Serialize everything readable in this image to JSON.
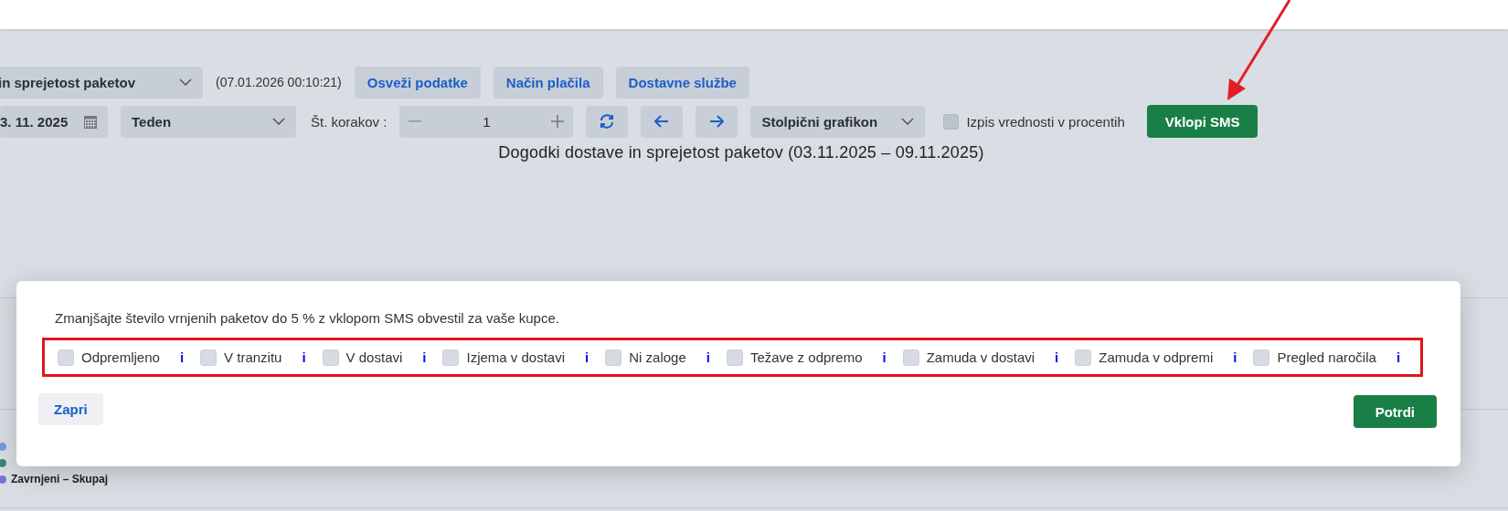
{
  "toolbar": {
    "report_select": {
      "value": "in sprejetost paketov"
    },
    "timestamp": "(07.01.2026 00:10:21)",
    "buttons": [
      "Osveži podatke",
      "Način plačila",
      "Dostavne službe"
    ],
    "date_field": {
      "value": "3. 11. 2025"
    },
    "period_select": {
      "value": "Teden"
    },
    "steps_label": "Št. korakov :",
    "steps_field": {
      "value": "1"
    },
    "chart_type_select": {
      "value": "Stolpični grafikon"
    },
    "percent_checkbox": {
      "label": "Izpis vrednosti v procentih",
      "checked": false
    },
    "sms_button": "Vklopi SMS"
  },
  "chart_title": "Dogodki dostave in sprejetost paketov (03.11.2025 – 09.11.2025)",
  "legend": [
    {
      "color": "#6f9fd6"
    },
    {
      "color": "#2f8a7c"
    },
    {
      "label": "Zavrnjeni – Skupaj",
      "color": "#7d72d4"
    }
  ],
  "modal": {
    "message": "Zmanjšajte število vrnjenih paketov do 5 % z vklopom SMS obvestil za vaše kupce.",
    "options": [
      {
        "label": "Odpremljeno",
        "checked": false,
        "info": "i"
      },
      {
        "label": "V tranzitu",
        "checked": false,
        "info": "i"
      },
      {
        "label": "V dostavi",
        "checked": false,
        "info": "i"
      },
      {
        "label": "Izjema v dostavi",
        "checked": false,
        "info": "i"
      },
      {
        "label": "Ni zaloge",
        "checked": false,
        "info": "i"
      },
      {
        "label": "Težave z odpremo",
        "checked": false,
        "info": "i"
      },
      {
        "label": "Zamuda v dostavi",
        "checked": false,
        "info": "i"
      },
      {
        "label": "Zamuda v odpremi",
        "checked": false,
        "info": "i"
      },
      {
        "label": "Pregled naročila",
        "checked": false,
        "info": "i"
      }
    ],
    "close_button": "Zapri",
    "confirm_button": "Potrdi"
  }
}
